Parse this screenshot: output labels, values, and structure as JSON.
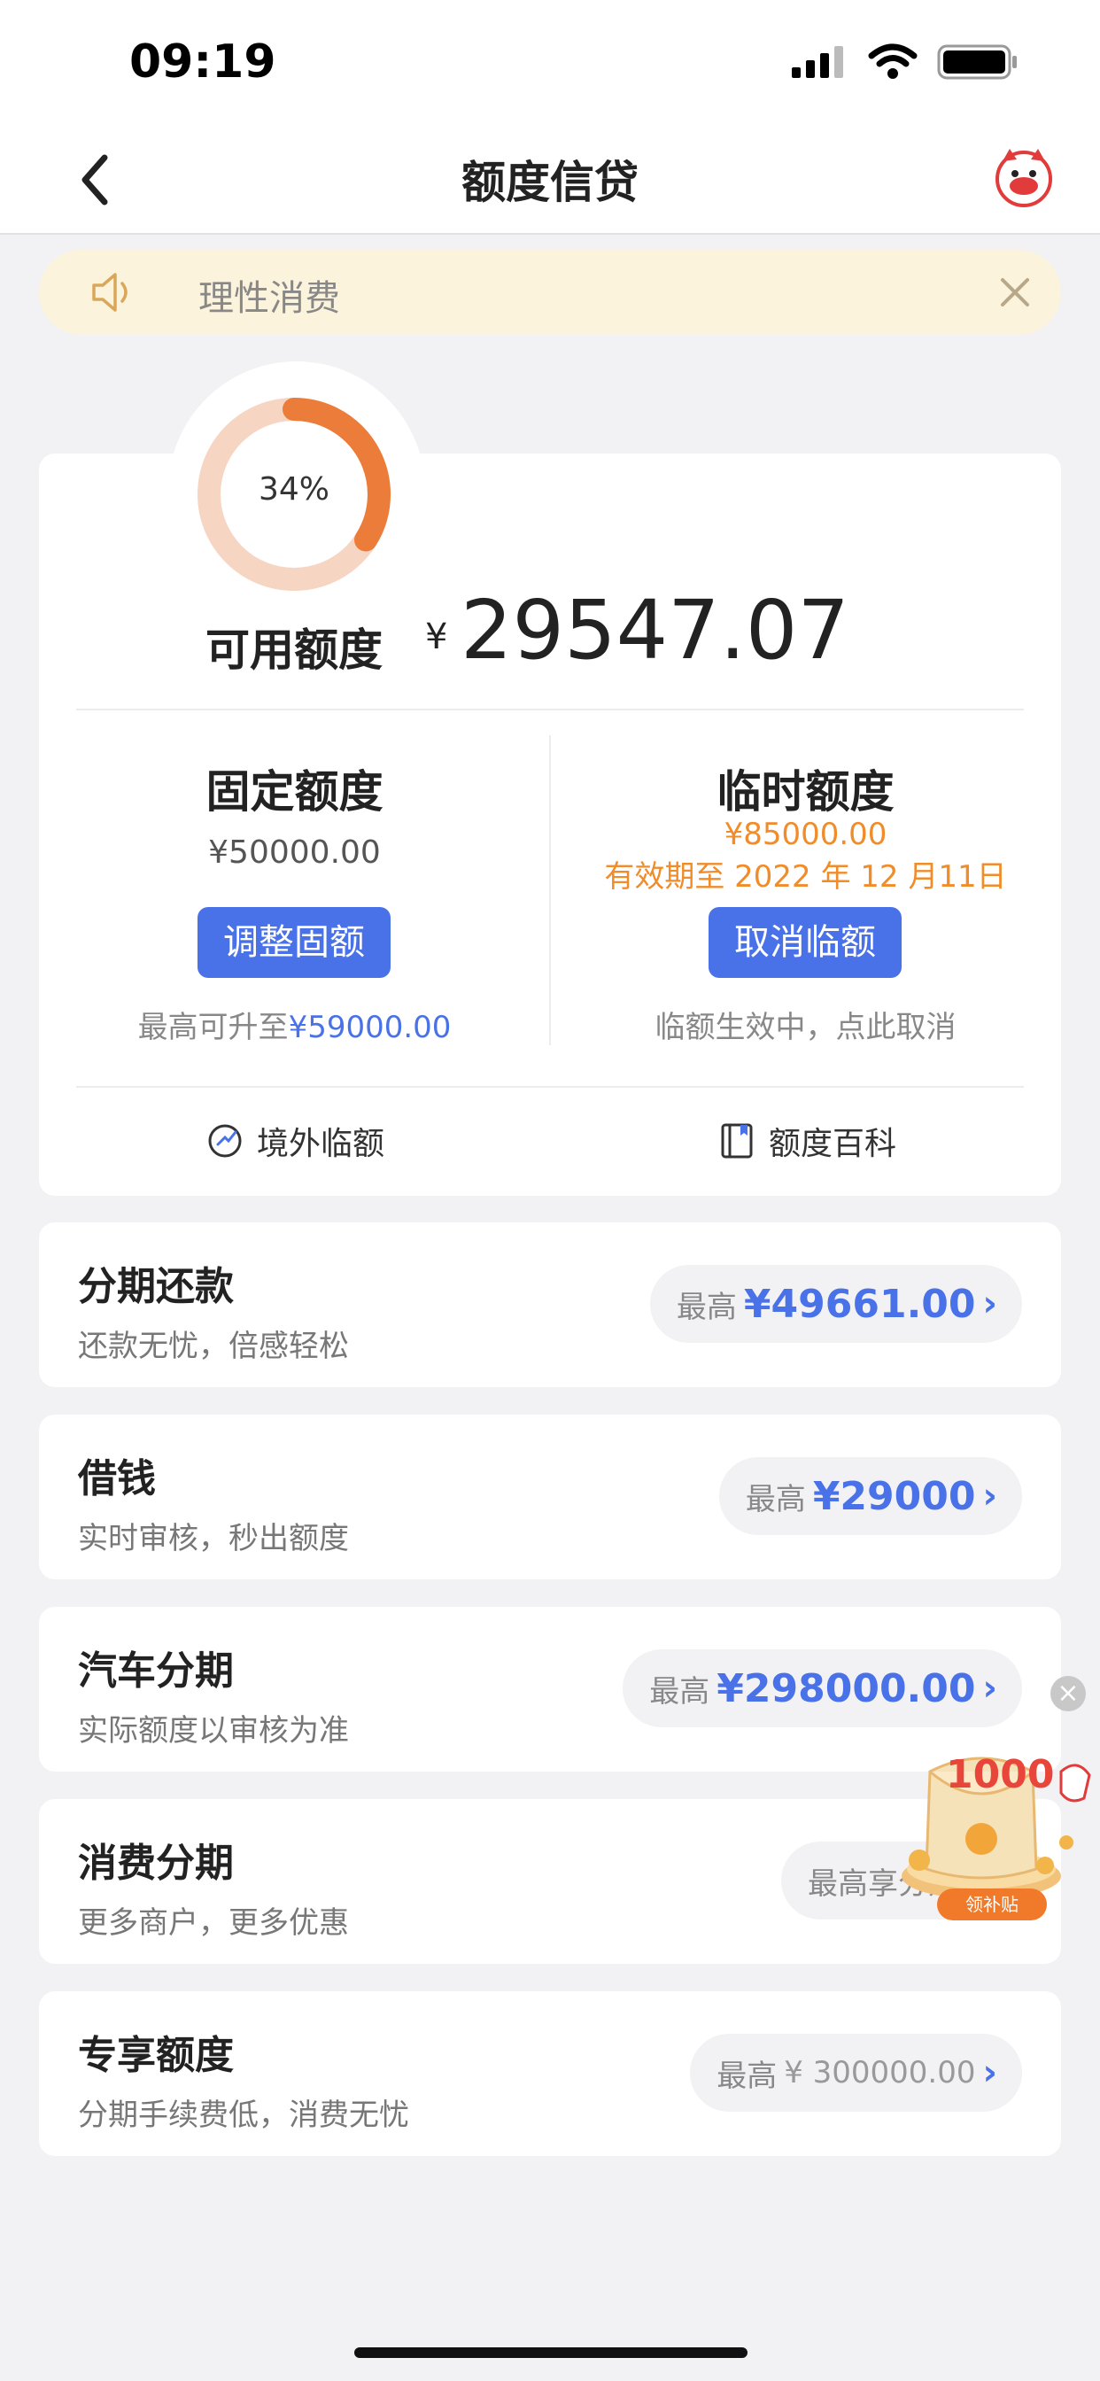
{
  "status": {
    "time": "09:19"
  },
  "nav": {
    "title": "额度信贷"
  },
  "notice": {
    "text": "理性消费"
  },
  "credit": {
    "usage_percent_label": "34%",
    "usage_fraction": 0.34,
    "available_label": "可用额度",
    "currency": "¥",
    "available_amount": "29547.07",
    "fixed": {
      "title": "固定额度",
      "amount": "¥50000.00",
      "button": "调整固额",
      "hint_prefix": "最高可升至",
      "hint_amount": "¥59000.00"
    },
    "temp": {
      "title": "临时额度",
      "amount": "¥85000.00",
      "validity": "有效期至 2022 年 12 月11日",
      "button": "取消临额",
      "hint": "临额生效中，点此取消"
    },
    "quick_links": [
      {
        "label": "境外临额",
        "icon": "overseas-icon"
      },
      {
        "label": "额度百科",
        "icon": "book-icon"
      }
    ]
  },
  "services": [
    {
      "title": "分期还款",
      "subtitle": "还款无忧，倍感轻松",
      "prefix": "最高",
      "amount": "¥49661.00"
    },
    {
      "title": "借钱",
      "subtitle": "实时审核，秒出额度",
      "prefix": "最高",
      "amount": "¥29000"
    },
    {
      "title": "汽车分期",
      "subtitle": "实际额度以审核为准",
      "prefix": "最高",
      "amount": "¥298000.00"
    },
    {
      "title": "消费分期",
      "subtitle": "更多商户，更多优惠",
      "prefix": "最高享分期免费"
    },
    {
      "title": "专享额度",
      "subtitle": "分期手续费低，消费无忧",
      "prefix": "最高",
      "amount": "¥ 300000.00"
    }
  ],
  "promo": {
    "amount": "1000",
    "button": "领补贴"
  },
  "colors": {
    "accent": "#4a72e8",
    "orange": "#f0822a",
    "warning_text": "#f08c2a"
  }
}
